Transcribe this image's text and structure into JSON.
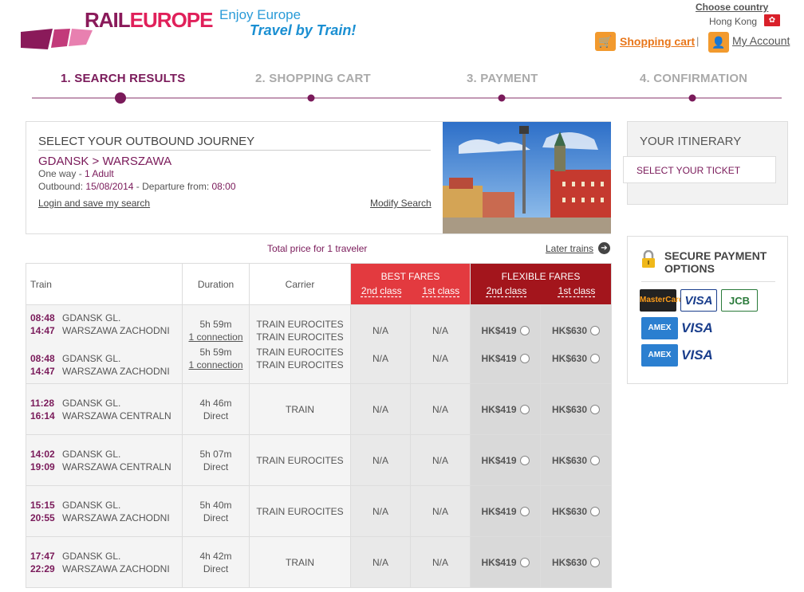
{
  "header": {
    "logo_text_a": "RAIL",
    "logo_text_b": "EUROPE",
    "tagline_1": "Enjoy Europe",
    "tagline_2": "Travel by Train!",
    "choose_country": "Choose country",
    "country": "Hong Kong",
    "shopping_cart": "Shopping cart",
    "separator": "|",
    "my_account": "My Account"
  },
  "steps": [
    "1. SEARCH RESULTS",
    "2. SHOPPING CART",
    "3. PAYMENT",
    "4. CONFIRMATION"
  ],
  "journey": {
    "title": "SELECT YOUR OUTBOUND JOURNEY",
    "route": "GDANSK > WARSZAWA",
    "trip_type": "One way - ",
    "passengers": "1 Adult",
    "outbound_label": "Outbound: ",
    "outbound_date": "15/08/2014",
    "departure_label": " - Departure from: ",
    "departure_time": "08:00",
    "login_link": "Login and save my search",
    "modify_link": "Modify Search"
  },
  "total_price_label": "Total price for 1 traveler",
  "later_trains": "Later trains",
  "table": {
    "headers": {
      "train": "Train",
      "duration": "Duration",
      "carrier": "Carrier",
      "best": "BEST FARES",
      "flexible": "FLEXIBLE FARES",
      "second": "2nd class",
      "first": "1st class"
    },
    "rows": [
      {
        "legs": [
          {
            "dep_time": "08:48",
            "dep_station": "GDANSK GL.",
            "arr_time": "14:47",
            "arr_station": "WARSZAWA ZACHODNI",
            "duration": "5h 59m",
            "connections": "1 connection",
            "carrier_1": "TRAIN EUROCITES",
            "carrier_2": "TRAIN EUROCITES",
            "best_2nd": "N/A",
            "best_1st": "N/A",
            "flex_2nd": "HK$419",
            "flex_1st": "HK$630"
          },
          {
            "dep_time": "08:48",
            "dep_station": "GDANSK GL.",
            "arr_time": "14:47",
            "arr_station": "WARSZAWA ZACHODNI",
            "duration": "5h 59m",
            "connections": "1 connection",
            "carrier_1": "TRAIN EUROCITES",
            "carrier_2": "TRAIN EUROCITES",
            "best_2nd": "N/A",
            "best_1st": "N/A",
            "flex_2nd": "HK$419",
            "flex_1st": "HK$630"
          }
        ]
      },
      {
        "legs": [
          {
            "dep_time": "11:28",
            "dep_station": "GDANSK GL.",
            "arr_time": "16:14",
            "arr_station": "WARSZAWA CENTRALN",
            "duration": "4h 46m",
            "connections": "Direct",
            "carrier_1": "TRAIN",
            "carrier_2": "",
            "best_2nd": "N/A",
            "best_1st": "N/A",
            "flex_2nd": "HK$419",
            "flex_1st": "HK$630"
          }
        ]
      },
      {
        "legs": [
          {
            "dep_time": "14:02",
            "dep_station": "GDANSK GL.",
            "arr_time": "19:09",
            "arr_station": "WARSZAWA CENTRALN",
            "duration": "5h 07m",
            "connections": "Direct",
            "carrier_1": "TRAIN EUROCITES",
            "carrier_2": "",
            "best_2nd": "N/A",
            "best_1st": "N/A",
            "flex_2nd": "HK$419",
            "flex_1st": "HK$630"
          }
        ]
      },
      {
        "legs": [
          {
            "dep_time": "15:15",
            "dep_station": "GDANSK GL.",
            "arr_time": "20:55",
            "arr_station": "WARSZAWA ZACHODNI",
            "duration": "5h 40m",
            "connections": "Direct",
            "carrier_1": "TRAIN EUROCITES",
            "carrier_2": "",
            "best_2nd": "N/A",
            "best_1st": "N/A",
            "flex_2nd": "HK$419",
            "flex_1st": "HK$630"
          }
        ]
      },
      {
        "legs": [
          {
            "dep_time": "17:47",
            "dep_station": "GDANSK GL.",
            "arr_time": "22:29",
            "arr_station": "WARSZAWA ZACHODNI",
            "duration": "4h 42m",
            "connections": "Direct",
            "carrier_1": "TRAIN",
            "carrier_2": "",
            "best_2nd": "N/A",
            "best_1st": "N/A",
            "flex_2nd": "HK$419",
            "flex_1st": "HK$630"
          }
        ]
      }
    ]
  },
  "itinerary": {
    "title": "YOUR ITINERARY",
    "select_ticket": "SELECT YOUR TICKET"
  },
  "secure_payment": {
    "title_1": "SECURE PAYMENT",
    "title_2": "OPTIONS",
    "cards": [
      "MasterCard",
      "VISA",
      "JCB",
      "AMEX",
      "VISA",
      "AMEX",
      "VISA"
    ]
  },
  "colors": {
    "brand": "#7a1a5a",
    "best_fares": "#e33a3f",
    "flexible_fares": "#a3151c",
    "cart": "#e8761a"
  }
}
